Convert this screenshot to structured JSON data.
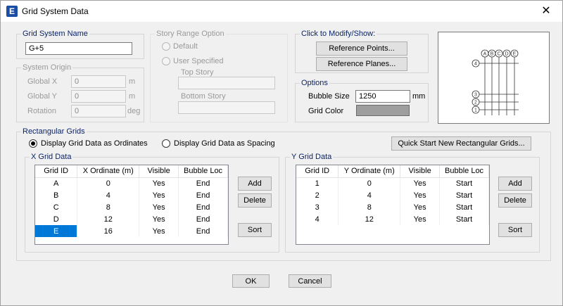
{
  "window": {
    "title": "Grid System Data",
    "app_icon_letter": "E",
    "close_glyph": "✕"
  },
  "grid_system_name": {
    "label": "Grid System Name",
    "value": "G+5"
  },
  "system_origin": {
    "label": "System Origin",
    "global_x": {
      "label": "Global  X",
      "value": "0",
      "unit": "m"
    },
    "global_y": {
      "label": "Global  Y",
      "value": "0",
      "unit": "m"
    },
    "rotation": {
      "label": "Rotation",
      "value": "0",
      "unit": "deg"
    }
  },
  "story_range": {
    "label": "Story Range Option",
    "default_label": "Default",
    "user_specified_label": "User Specified",
    "top_story_label": "Top Story",
    "bottom_story_label": "Bottom Story"
  },
  "modify_show": {
    "label": "Click to Modify/Show:",
    "reference_points": "Reference Points...",
    "reference_planes": "Reference Planes..."
  },
  "options": {
    "label": "Options",
    "bubble_size_label": "Bubble Size",
    "bubble_size_value": "1250",
    "bubble_size_unit": "mm",
    "grid_color_label": "Grid Color",
    "grid_color_hex": "#9e9e9e"
  },
  "preview": {
    "x_bubbles": [
      "A",
      "B",
      "C",
      "D",
      "E"
    ],
    "y_bubbles": [
      "4",
      "3",
      "2",
      "1"
    ]
  },
  "rect_grids": {
    "label": "Rectangular Grids",
    "display_ordinates": "Display Grid Data as Ordinates",
    "display_spacing": "Display Grid Data as Spacing",
    "quick_start": "Quick Start New Rectangular Grids..."
  },
  "x_grid": {
    "label": "X Grid Data",
    "columns": [
      "Grid ID",
      "X Ordinate (m)",
      "Visible",
      "Bubble Loc"
    ],
    "rows": [
      [
        "A",
        "0",
        "Yes",
        "End"
      ],
      [
        "B",
        "4",
        "Yes",
        "End"
      ],
      [
        "C",
        "8",
        "Yes",
        "End"
      ],
      [
        "D",
        "12",
        "Yes",
        "End"
      ],
      [
        "E",
        "16",
        "Yes",
        "End"
      ]
    ],
    "add": "Add",
    "delete": "Delete",
    "sort": "Sort"
  },
  "y_grid": {
    "label": "Y Grid Data",
    "columns": [
      "Grid ID",
      "Y Ordinate (m)",
      "Visible",
      "Bubble Loc"
    ],
    "rows": [
      [
        "1",
        "0",
        "Yes",
        "Start"
      ],
      [
        "2",
        "4",
        "Yes",
        "Start"
      ],
      [
        "3",
        "8",
        "Yes",
        "Start"
      ],
      [
        "4",
        "12",
        "Yes",
        "Start"
      ]
    ],
    "add": "Add",
    "delete": "Delete",
    "sort": "Sort"
  },
  "footer": {
    "ok": "OK",
    "cancel": "Cancel"
  }
}
